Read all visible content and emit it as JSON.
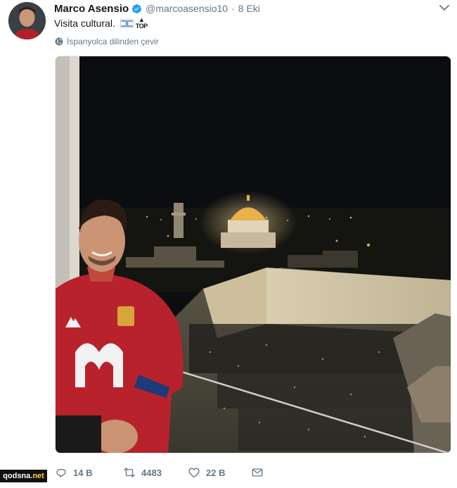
{
  "tweet": {
    "display_name": "Marco Asensio",
    "handle": "@marcoasensio10",
    "separator": "·",
    "date": "8 Eki",
    "text": "Visita cultural.",
    "top_emoji_text": "TOP",
    "translate_label": "İspanyolca dilinden çevir"
  },
  "actions": {
    "replies": "14 B",
    "retweets": "4483",
    "likes": "22 B"
  },
  "watermark": {
    "name": "qodsna",
    "ext": ".net"
  },
  "icons": {
    "verified": "verified-badge-icon",
    "caret": "chevron-down-icon",
    "globe": "globe-icon",
    "reply": "reply-icon",
    "retweet": "retweet-icon",
    "like": "heart-icon",
    "message": "envelope-icon"
  },
  "colors": {
    "accent": "#1da1f2",
    "muted": "#657786",
    "text": "#14171a"
  }
}
